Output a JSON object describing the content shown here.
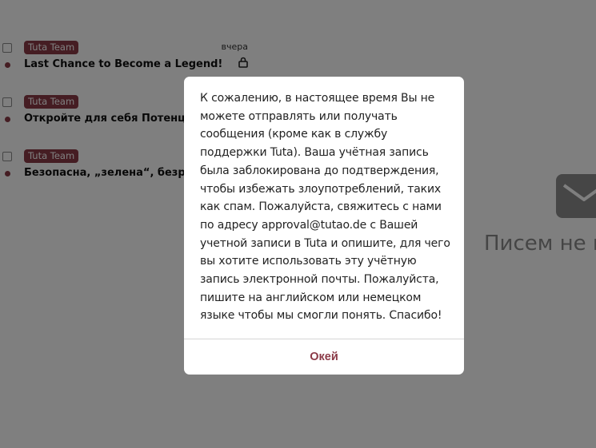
{
  "mail_list": {
    "rows": [
      {
        "sender": "Tuta Team",
        "date": "вчера",
        "subject": "Last Chance to Become a Legend!"
      },
      {
        "sender": "Tuta Team",
        "date": "",
        "subject": "Откройте для себя Потенциал"
      },
      {
        "sender": "Tuta Team",
        "date": "",
        "subject": "Безопасна, „зелена“, безрекл"
      }
    ]
  },
  "empty_state": {
    "text": "Писем не в",
    "icon": "envelope-icon"
  },
  "dialog": {
    "message": "К сожалению, в настоящее время Вы не можете отправлять или получать сообщения (кроме как в службу поддержки Tuta). Ваша учётная запись была заблокирована до подтверждения, чтобы избежать злоупотреблений, таких как спам. Пожалуйста, свяжитесь с нами по адресу approval@tutao.de с Вашей учетной записи в Tuta и опишите, для чего вы хотите использовать эту учётную запись электронной почты. Пожалуйста, пишите на английском или немецком языке чтобы мы смогли понять. Спасибо!",
    "ok_label": "Окей"
  },
  "colors": {
    "accent": "#8b3a47",
    "overlay": "rgba(0,0,0,0.5)"
  }
}
